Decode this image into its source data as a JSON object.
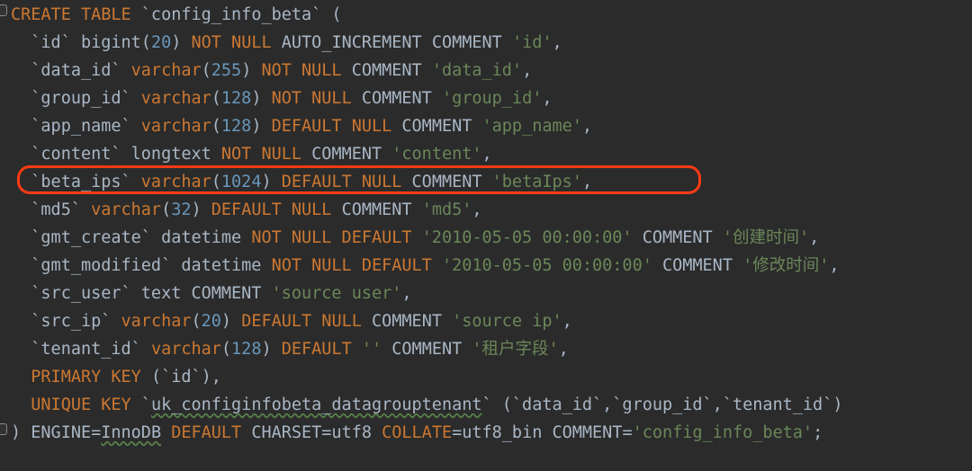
{
  "editor": {
    "theme": "darcula",
    "background_color": "#2b2b2b",
    "default_text_color": "#a9b7c6",
    "keyword_color": "#cc7832",
    "number_color": "#6897bb",
    "string_color": "#6a8759",
    "annotation_color": "#ff3b14",
    "language": "sql"
  },
  "gutter": {
    "fold_top": "fold-collapse-marker",
    "fold_bottom": "fold-collapse-marker"
  },
  "annotation": {
    "shape": "rounded-rectangle",
    "target_line_index": 6,
    "target_line_text": "`beta_ips` varchar(1024) DEFAULT NULL COMMENT 'betaIps',"
  },
  "code": {
    "full_text": "CREATE TABLE `config_info_beta` (\n  `id` bigint(20) NOT NULL AUTO_INCREMENT COMMENT 'id',\n  `data_id` varchar(255) NOT NULL COMMENT 'data_id',\n  `group_id` varchar(128) NOT NULL COMMENT 'group_id',\n  `app_name` varchar(128) DEFAULT NULL COMMENT 'app_name',\n  `content` longtext NOT NULL COMMENT 'content',\n  `beta_ips` varchar(1024) DEFAULT NULL COMMENT 'betaIps',\n  `md5` varchar(32) DEFAULT NULL COMMENT 'md5',\n  `gmt_create` datetime NOT NULL DEFAULT '2010-05-05 00:00:00' COMMENT '创建时间',\n  `gmt_modified` datetime NOT NULL DEFAULT '2010-05-05 00:00:00' COMMENT '修改时间',\n  `src_user` text COMMENT 'source user',\n  `src_ip` varchar(20) DEFAULT NULL COMMENT 'source ip',\n  `tenant_id` varchar(128) DEFAULT '' COMMENT '租户字段',\n  PRIMARY KEY (`id`),\n  UNIQUE KEY `uk_configinfobeta_datagrouptenant` (`data_id`,`group_id`,`tenant_id`)\n) ENGINE=InnoDB DEFAULT CHARSET=utf8 COLLATE=utf8_bin COMMENT='config_info_beta';",
    "lines": [
      {
        "index": 0,
        "text": "CREATE TABLE `config_info_beta` (",
        "tokens": [
          {
            "t": "CREATE TABLE ",
            "c": "kw"
          },
          {
            "t": "`config_info_beta` (",
            "c": "def"
          }
        ]
      },
      {
        "index": 1,
        "text": "  `id` bigint(20) NOT NULL AUTO_INCREMENT COMMENT 'id',",
        "tokens": [
          {
            "t": "  `id` bigint(",
            "c": "def"
          },
          {
            "t": "20",
            "c": "num"
          },
          {
            "t": ") ",
            "c": "def"
          },
          {
            "t": "NOT NULL ",
            "c": "kw"
          },
          {
            "t": "AUTO_INCREMENT COMMENT ",
            "c": "def"
          },
          {
            "t": "'id'",
            "c": "str"
          },
          {
            "t": ",",
            "c": "def"
          }
        ]
      },
      {
        "index": 2,
        "text": "  `data_id` varchar(255) NOT NULL COMMENT 'data_id',",
        "tokens": [
          {
            "t": "  `data_id` ",
            "c": "def"
          },
          {
            "t": "varchar",
            "c": "kw"
          },
          {
            "t": "(",
            "c": "def"
          },
          {
            "t": "255",
            "c": "num"
          },
          {
            "t": ") ",
            "c": "def"
          },
          {
            "t": "NOT NULL ",
            "c": "kw"
          },
          {
            "t": "COMMENT ",
            "c": "def"
          },
          {
            "t": "'data_id'",
            "c": "str"
          },
          {
            "t": ",",
            "c": "def"
          }
        ]
      },
      {
        "index": 3,
        "text": "  `group_id` varchar(128) NOT NULL COMMENT 'group_id',",
        "tokens": [
          {
            "t": "  `group_id` ",
            "c": "def"
          },
          {
            "t": "varchar",
            "c": "kw"
          },
          {
            "t": "(",
            "c": "def"
          },
          {
            "t": "128",
            "c": "num"
          },
          {
            "t": ") ",
            "c": "def"
          },
          {
            "t": "NOT NULL ",
            "c": "kw"
          },
          {
            "t": "COMMENT ",
            "c": "def"
          },
          {
            "t": "'group_id'",
            "c": "str"
          },
          {
            "t": ",",
            "c": "def"
          }
        ]
      },
      {
        "index": 4,
        "text": "  `app_name` varchar(128) DEFAULT NULL COMMENT 'app_name',",
        "tokens": [
          {
            "t": "  `app_name` ",
            "c": "def"
          },
          {
            "t": "varchar",
            "c": "kw"
          },
          {
            "t": "(",
            "c": "def"
          },
          {
            "t": "128",
            "c": "num"
          },
          {
            "t": ") ",
            "c": "def"
          },
          {
            "t": "DEFAULT NULL ",
            "c": "kw"
          },
          {
            "t": "COMMENT ",
            "c": "def"
          },
          {
            "t": "'app_name'",
            "c": "str"
          },
          {
            "t": ",",
            "c": "def"
          }
        ]
      },
      {
        "index": 5,
        "text": "  `content` longtext NOT NULL COMMENT 'content',",
        "tokens": [
          {
            "t": "  `content` longtext ",
            "c": "def"
          },
          {
            "t": "NOT NULL ",
            "c": "kw"
          },
          {
            "t": "COMMENT ",
            "c": "def"
          },
          {
            "t": "'content'",
            "c": "str"
          },
          {
            "t": ",",
            "c": "def"
          }
        ]
      },
      {
        "index": 6,
        "text": "  `beta_ips` varchar(1024) DEFAULT NULL COMMENT 'betaIps',",
        "highlighted": true,
        "tokens": [
          {
            "t": "  `beta_ips` ",
            "c": "def"
          },
          {
            "t": "varchar",
            "c": "kw"
          },
          {
            "t": "(",
            "c": "def"
          },
          {
            "t": "1024",
            "c": "num"
          },
          {
            "t": ") ",
            "c": "def"
          },
          {
            "t": "DEFAULT NULL ",
            "c": "kw"
          },
          {
            "t": "COMMENT ",
            "c": "def"
          },
          {
            "t": "'betaIps'",
            "c": "str"
          },
          {
            "t": ",",
            "c": "def"
          }
        ]
      },
      {
        "index": 7,
        "text": "  `md5` varchar(32) DEFAULT NULL COMMENT 'md5',",
        "tokens": [
          {
            "t": "  `md5` ",
            "c": "def"
          },
          {
            "t": "varchar",
            "c": "kw"
          },
          {
            "t": "(",
            "c": "def"
          },
          {
            "t": "32",
            "c": "num"
          },
          {
            "t": ") ",
            "c": "def"
          },
          {
            "t": "DEFAULT NULL ",
            "c": "kw"
          },
          {
            "t": "COMMENT ",
            "c": "def"
          },
          {
            "t": "'md5'",
            "c": "str"
          },
          {
            "t": ",",
            "c": "def"
          }
        ]
      },
      {
        "index": 8,
        "text": "  `gmt_create` datetime NOT NULL DEFAULT '2010-05-05 00:00:00' COMMENT '创建时间',",
        "tokens": [
          {
            "t": "  `gmt_create` datetime ",
            "c": "def"
          },
          {
            "t": "NOT NULL DEFAULT ",
            "c": "kw"
          },
          {
            "t": "'2010-05-05 00:00:00'",
            "c": "str"
          },
          {
            "t": " COMMENT ",
            "c": "def"
          },
          {
            "t": "'创建时间'",
            "c": "str"
          },
          {
            "t": ",",
            "c": "def"
          }
        ]
      },
      {
        "index": 9,
        "text": "  `gmt_modified` datetime NOT NULL DEFAULT '2010-05-05 00:00:00' COMMENT '修改时间',",
        "tokens": [
          {
            "t": "  `gmt_modified` datetime ",
            "c": "def"
          },
          {
            "t": "NOT NULL DEFAULT ",
            "c": "kw"
          },
          {
            "t": "'2010-05-05 00:00:00'",
            "c": "str"
          },
          {
            "t": " COMMENT ",
            "c": "def"
          },
          {
            "t": "'修改时间'",
            "c": "str"
          },
          {
            "t": ",",
            "c": "def"
          }
        ]
      },
      {
        "index": 10,
        "text": "  `src_user` text COMMENT 'source user',",
        "tokens": [
          {
            "t": "  `src_user` text COMMENT ",
            "c": "def"
          },
          {
            "t": "'source user'",
            "c": "str"
          },
          {
            "t": ",",
            "c": "def"
          }
        ]
      },
      {
        "index": 11,
        "text": "  `src_ip` varchar(20) DEFAULT NULL COMMENT 'source ip',",
        "tokens": [
          {
            "t": "  `src_ip` ",
            "c": "def"
          },
          {
            "t": "varchar",
            "c": "kw"
          },
          {
            "t": "(",
            "c": "def"
          },
          {
            "t": "20",
            "c": "num"
          },
          {
            "t": ") ",
            "c": "def"
          },
          {
            "t": "DEFAULT NULL ",
            "c": "kw"
          },
          {
            "t": "COMMENT ",
            "c": "def"
          },
          {
            "t": "'source ip'",
            "c": "str"
          },
          {
            "t": ",",
            "c": "def"
          }
        ]
      },
      {
        "index": 12,
        "text": "  `tenant_id` varchar(128) DEFAULT '' COMMENT '租户字段',",
        "tokens": [
          {
            "t": "  `tenant_id` ",
            "c": "def"
          },
          {
            "t": "varchar",
            "c": "kw"
          },
          {
            "t": "(",
            "c": "def"
          },
          {
            "t": "128",
            "c": "num"
          },
          {
            "t": ") ",
            "c": "def"
          },
          {
            "t": "DEFAULT ",
            "c": "kw"
          },
          {
            "t": "''",
            "c": "str"
          },
          {
            "t": " COMMENT ",
            "c": "def"
          },
          {
            "t": "'租户字段'",
            "c": "str"
          },
          {
            "t": ",",
            "c": "def"
          }
        ]
      },
      {
        "index": 13,
        "text": "  PRIMARY KEY (`id`),",
        "tokens": [
          {
            "t": "  PRIMARY KEY ",
            "c": "kw"
          },
          {
            "t": "(`id`),",
            "c": "def"
          }
        ]
      },
      {
        "index": 14,
        "text": "  UNIQUE KEY `uk_configinfobeta_datagrouptenant` (`data_id`,`group_id`,`tenant_id`)",
        "tokens": [
          {
            "t": "  UNIQUE KEY ",
            "c": "kw"
          },
          {
            "t": "`",
            "c": "def"
          },
          {
            "t": "uk_configinfobeta_datagrouptenant",
            "c": "def sq"
          },
          {
            "t": "` (`data_id`,`group_id`,`tenant_id`)",
            "c": "def"
          }
        ]
      },
      {
        "index": 15,
        "text": ") ENGINE=InnoDB DEFAULT CHARSET=utf8 COLLATE=utf8_bin COMMENT='config_info_beta';",
        "tokens": [
          {
            "t": ") ENGINE=",
            "c": "def"
          },
          {
            "t": "InnoDB",
            "c": "def sq"
          },
          {
            "t": " ",
            "c": "def"
          },
          {
            "t": "DEFAULT ",
            "c": "kw"
          },
          {
            "t": "CHARSET=utf8 ",
            "c": "def"
          },
          {
            "t": "COLLATE",
            "c": "kw"
          },
          {
            "t": "=utf8_bin COMMENT=",
            "c": "def"
          },
          {
            "t": "'config_info_beta'",
            "c": "str"
          },
          {
            "t": ";",
            "c": "def"
          }
        ]
      }
    ]
  }
}
